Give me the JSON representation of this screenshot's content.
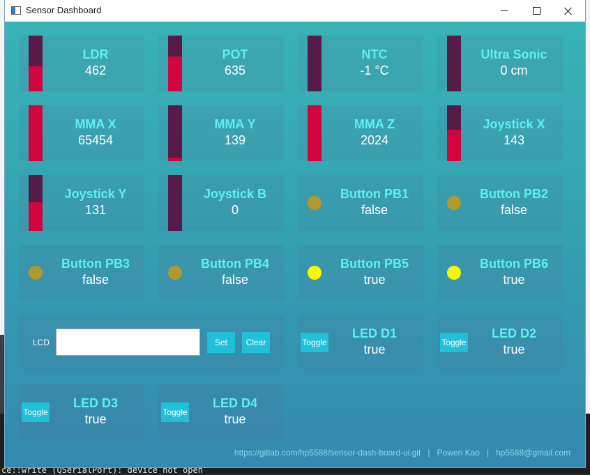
{
  "background": {
    "console_line": "ce::write (QSerialPort): device not open"
  },
  "window": {
    "title": "Sensor Dashboard"
  },
  "colors": {
    "bar_track": "#561b48",
    "bar_fill": "#d0053f",
    "led_off": "#b1992b",
    "led_on": "#fbf900",
    "name_text": "#5ef0ee",
    "button_bg": "#1fc0d8"
  },
  "sensors": [
    {
      "name": "LDR",
      "value": "462",
      "level": 0.45
    },
    {
      "name": "POT",
      "value": "635",
      "level": 0.62
    },
    {
      "name": "NTC",
      "value": "-1 °C",
      "level": 0.0
    },
    {
      "name": "Ultra Sonic",
      "value": "0 cm",
      "level": 0.0
    },
    {
      "name": "MMA X",
      "value": "65454",
      "level": 1.0
    },
    {
      "name": "MMA Y",
      "value": "139",
      "level": 0.06
    },
    {
      "name": "MMA Z",
      "value": "2024",
      "level": 1.0
    },
    {
      "name": "Joystick X",
      "value": "143",
      "level": 0.56
    },
    {
      "name": "Joystick Y",
      "value": "131",
      "level": 0.51
    },
    {
      "name": "Joystick B",
      "value": "0",
      "level": 0.0
    }
  ],
  "buttons": [
    {
      "name": "Button PB1",
      "value": "false",
      "on": false
    },
    {
      "name": "Button PB2",
      "value": "false",
      "on": false
    },
    {
      "name": "Button PB3",
      "value": "false",
      "on": false
    },
    {
      "name": "Button PB4",
      "value": "false",
      "on": false
    },
    {
      "name": "Button PB5",
      "value": "true",
      "on": true
    },
    {
      "name": "Button PB6",
      "value": "true",
      "on": true
    }
  ],
  "lcd": {
    "label": "LCD",
    "value": "",
    "set_label": "Set",
    "clear_label": "Clear"
  },
  "leds": [
    {
      "name": "LED D1",
      "value": "true",
      "toggle_label": "Toggle"
    },
    {
      "name": "LED D2",
      "value": "true",
      "toggle_label": "Toggle"
    },
    {
      "name": "LED D3",
      "value": "true",
      "toggle_label": "Toggle"
    },
    {
      "name": "LED D4",
      "value": "true",
      "toggle_label": "Toggle"
    }
  ],
  "footer": {
    "repo": "https://gitlab.com/hp5588/sensor-dash-board-ui.git",
    "separator": "|",
    "author": "Powen Kao",
    "email": "hp5588@gmail.com"
  }
}
